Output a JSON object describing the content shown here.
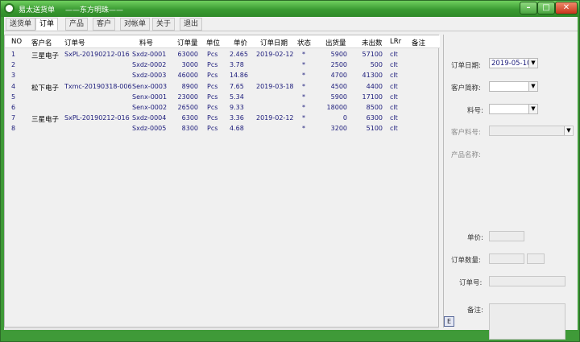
{
  "window": {
    "title": "易太送货单",
    "subtitle": "——东方明珠——",
    "min_label": "–",
    "max_label": "□",
    "close_label": "✕"
  },
  "menu": [
    {
      "label": "送货单"
    },
    {
      "label": "订单",
      "active": true
    },
    {
      "label": "产品"
    },
    {
      "label": "客户"
    },
    {
      "label": "对帐单"
    },
    {
      "label": "关于"
    },
    {
      "label": "退出"
    }
  ],
  "table": {
    "headers": [
      "NO",
      "客户名",
      "订单号",
      "料号",
      "订单量",
      "单位",
      "单价",
      "订单日期",
      "状态",
      "出货量",
      "未出数",
      "LRr",
      "备注"
    ],
    "rows": [
      [
        "1",
        "三星电子",
        "SxPL-20190212-016",
        "Sxdz-0001",
        "63000",
        "Pcs",
        "2.465",
        "2019-02-12",
        "*",
        "5900",
        "57100",
        "clt",
        ""
      ],
      [
        "2",
        "",
        "",
        "Sxdz-0002",
        "3000",
        "Pcs",
        "3.78",
        "",
        "*",
        "2500",
        "500",
        "clt",
        ""
      ],
      [
        "3",
        "",
        "",
        "Sxdz-0003",
        "46000",
        "Pcs",
        "14.86",
        "",
        "*",
        "4700",
        "41300",
        "clt",
        ""
      ],
      [
        "4",
        "松下电子",
        "Txmc-20190318-006",
        "Senx-0003",
        "8900",
        "Pcs",
        "7.65",
        "2019-03-18",
        "*",
        "4500",
        "4400",
        "clt",
        ""
      ],
      [
        "5",
        "",
        "",
        "Senx-0001",
        "23000",
        "Pcs",
        "5.34",
        "",
        "*",
        "5900",
        "17100",
        "clt",
        ""
      ],
      [
        "6",
        "",
        "",
        "Senx-0002",
        "26500",
        "Pcs",
        "9.33",
        "",
        "*",
        "18000",
        "8500",
        "clt",
        ""
      ],
      [
        "7",
        "三星电子",
        "SxPL-20190212-016",
        "Sxdz-0004",
        "6300",
        "Pcs",
        "3.36",
        "2019-02-12",
        "*",
        "0",
        "6300",
        "clt",
        ""
      ],
      [
        "8",
        "",
        "",
        "Sxdz-0005",
        "8300",
        "Pcs",
        "4.68",
        "",
        "*",
        "3200",
        "5100",
        "clt",
        ""
      ]
    ]
  },
  "form": {
    "order_date_label": "订单日期:",
    "order_date_value": "2019-05-10",
    "customer_short_label": "客户简称:",
    "part_no_label": "料号:",
    "customer_part_label": "客户料号:",
    "product_name_label": "产品名称:",
    "unit_price_label": "单价:",
    "order_qty_label": "订单数量:",
    "order_no_label": "订单号:",
    "remark_label": "备注:"
  },
  "status_icon": {
    "label": "E",
    "icon": "e-icon"
  }
}
